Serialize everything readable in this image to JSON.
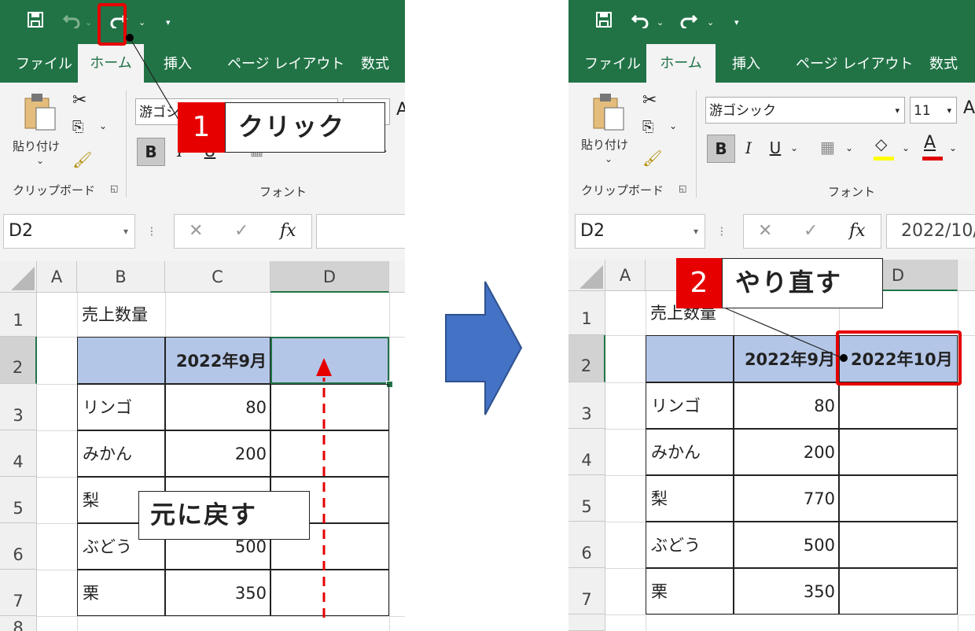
{
  "ribbon": {
    "tabs": [
      "ファイル",
      "ホーム",
      "挿入",
      "ページ レイアウト",
      "数式"
    ],
    "clipboard_label": "クリップボード",
    "font_group_label": "フォント",
    "paste_label": "貼り付け",
    "font_name": "游ゴシック",
    "font_name_truncated": "游ゴシ",
    "font_size": "11",
    "bold": "B",
    "italic": "I",
    "underline": "U",
    "font_color_letter": "A",
    "fx": "fx"
  },
  "left": {
    "name_box": "D2",
    "formula_value": "",
    "columns": [
      "A",
      "B",
      "C",
      "D"
    ],
    "rows": [
      "1",
      "2",
      "3",
      "4",
      "5",
      "6",
      "7",
      "8"
    ],
    "title_cell": "売上数量",
    "header_c": "2022年9月",
    "header_d": "",
    "items": [
      {
        "name": "リンゴ",
        "value": "80"
      },
      {
        "name": "みかん",
        "value": "200"
      },
      {
        "name": "梨",
        "value": ""
      },
      {
        "name": "ぶどう",
        "value": "500"
      },
      {
        "name": "栗",
        "value": "350"
      }
    ],
    "callout_number": "1",
    "callout_text": "クリック",
    "undo_note": "元に戻す"
  },
  "right": {
    "name_box": "D2",
    "formula_value": "2022/10/",
    "columns": [
      "A",
      "B",
      "C",
      "D"
    ],
    "rows": [
      "1",
      "2",
      "3",
      "4",
      "5",
      "6",
      "7"
    ],
    "title_cell": "売上数量",
    "header_c": "2022年9月",
    "header_d": "2022年10月",
    "items": [
      {
        "name": "リンゴ",
        "value": "80"
      },
      {
        "name": "みかん",
        "value": "200"
      },
      {
        "name": "梨",
        "value": "770"
      },
      {
        "name": "ぶどう",
        "value": "500"
      },
      {
        "name": "栗",
        "value": "350"
      }
    ],
    "callout_number": "2",
    "callout_text": "やり直す"
  },
  "colors": {
    "excel_green": "#217346",
    "header_fill": "#b4c6e7",
    "highlight_red": "#e60000",
    "arrow_blue": "#4472c4"
  },
  "icons": [
    "save-icon",
    "undo-icon",
    "redo-icon",
    "customize-qat-icon",
    "scissors-icon",
    "copy-icon",
    "format-painter-icon",
    "paste-icon",
    "cancel-icon",
    "enter-icon",
    "fx-icon",
    "fill-color-icon",
    "font-color-icon",
    "borders-icon"
  ]
}
